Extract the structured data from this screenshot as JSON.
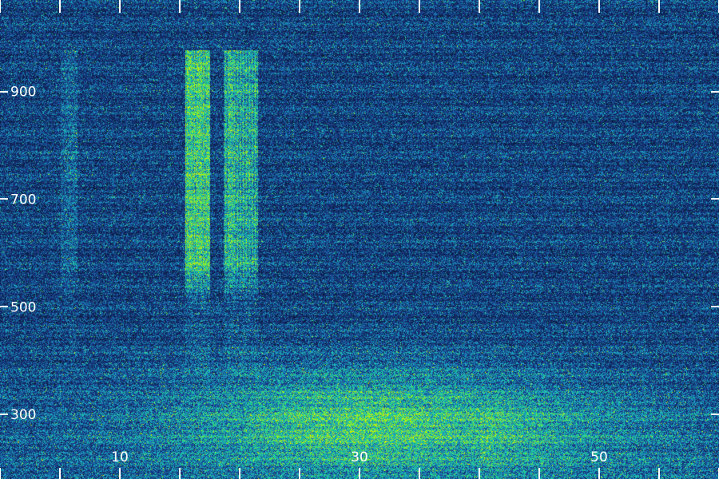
{
  "colors": {
    "background": "#0a1a3a",
    "low": "#1a3a8c",
    "mid": "#1aa7c8",
    "high": "#2ae27a",
    "peak": "#c8f000",
    "tick": "#ffffff"
  },
  "axes": {
    "x": {
      "range": [
        0,
        60
      ],
      "ticks": [
        0,
        5,
        10,
        15,
        20,
        25,
        30,
        35,
        40,
        45,
        50,
        55,
        60
      ],
      "labels": [
        {
          "value": 10,
          "text": "10"
        },
        {
          "value": 30,
          "text": "30"
        },
        {
          "value": 50,
          "text": "50"
        }
      ]
    },
    "y": {
      "range": [
        180,
        1070
      ],
      "ticks": [
        300,
        500,
        700,
        900
      ],
      "labels": [
        {
          "value": 300,
          "text": "300"
        },
        {
          "value": 500,
          "text": "500"
        },
        {
          "value": 700,
          "text": "700"
        },
        {
          "value": 900,
          "text": "900"
        }
      ]
    }
  }
}
